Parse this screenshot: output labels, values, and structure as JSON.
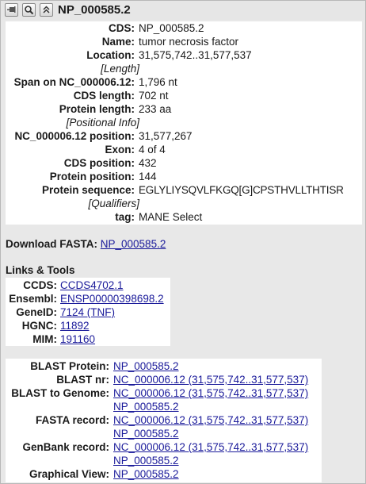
{
  "panel": {
    "title": "NP_000585.2"
  },
  "info": {
    "cds_label": "CDS:",
    "cds_value": "NP_000585.2",
    "name_label": "Name:",
    "name_value": "tumor necrosis factor",
    "location_label": "Location:",
    "location_value": "31,575,742..31,577,537",
    "length_section": "Length",
    "span_label": "Span on NC_000006.12:",
    "span_value": "1,796 nt",
    "cds_length_label": "CDS length:",
    "cds_length_value": "702 nt",
    "protein_length_label": "Protein length:",
    "protein_length_value": "233 aa",
    "positional_section": "Positional Info",
    "nc_position_label": "NC_000006.12 position:",
    "nc_position_value": "31,577,267",
    "exon_label": "Exon:",
    "exon_value": "4 of 4",
    "cds_position_label": "CDS position:",
    "cds_position_value": "432",
    "protein_position_label": "Protein position:",
    "protein_position_value": "144",
    "protein_sequence_label": "Protein sequence:",
    "protein_sequence_value": "EGLYLIYSQVLFKGQ[G]CPSTHVLLTHTISR",
    "qualifiers_section": "Qualifiers",
    "tag_label": "tag:",
    "tag_value": "MANE Select"
  },
  "download": {
    "label": "Download FASTA:",
    "link": "NP_000585.2"
  },
  "links_tools": {
    "heading": "Links & Tools",
    "ccds_label": "CCDS:",
    "ccds_link": "CCDS4702.1",
    "ensembl_label": "Ensembl:",
    "ensembl_link": "ENSP00000398698.2",
    "geneid_label": "GeneID:",
    "geneid_link": "7124 (TNF)",
    "hgnc_label": "HGNC:",
    "hgnc_link": "11892",
    "mim_label": "MIM:",
    "mim_link": "191160"
  },
  "tools": {
    "blast_protein_label": "BLAST Protein:",
    "blast_protein_link": "NP_000585.2",
    "blast_nr_label": "BLAST nr:",
    "blast_nr_link": "NC_000006.12 (31,575,742..31,577,537)",
    "blast_genome_label": "BLAST to Genome:",
    "blast_genome_link": "NC_000006.12 (31,575,742..31,577,537)",
    "blast_genome_link2": "NP_000585.2",
    "fasta_record_label": "FASTA record:",
    "fasta_record_link": "NC_000006.12 (31,575,742..31,577,537)",
    "fasta_record_link2": "NP_000585.2",
    "genbank_record_label": "GenBank record:",
    "genbank_record_link": "NC_000006.12 (31,575,742..31,577,537)",
    "genbank_record_link2": "NP_000585.2",
    "graphical_view_label": "Graphical View:",
    "graphical_view_link": "NP_000585.2"
  }
}
